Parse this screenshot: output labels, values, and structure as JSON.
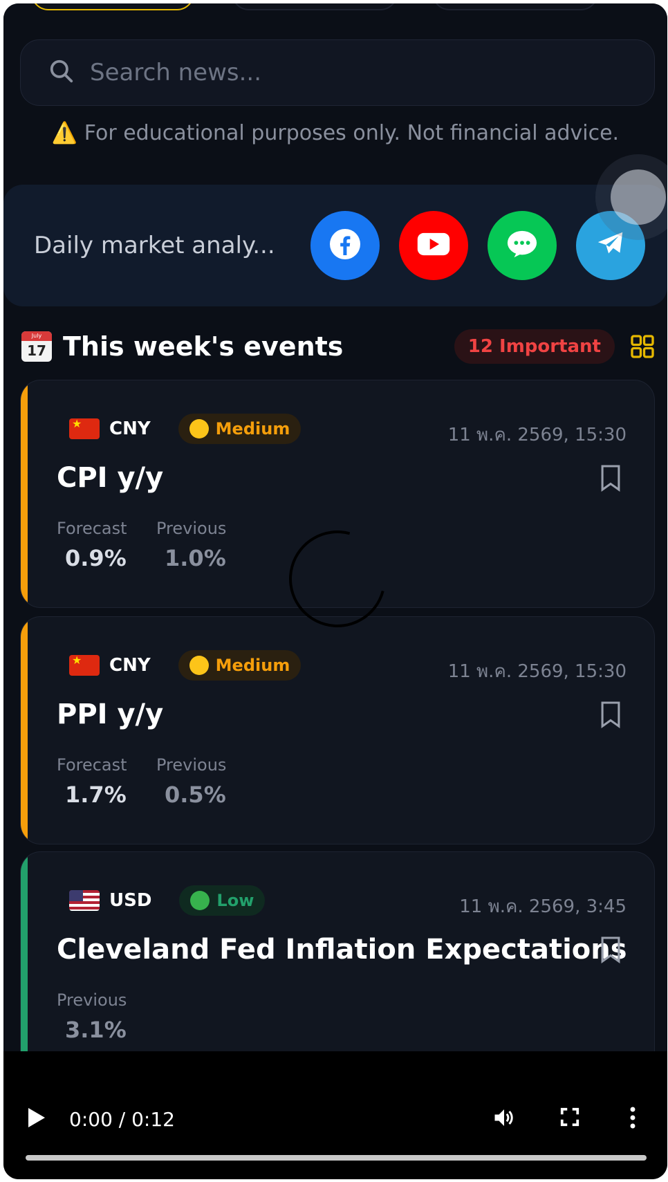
{
  "search": {
    "placeholder": "Search news..."
  },
  "disclaimer": "⚠️ For educational purposes only. Not financial advice.",
  "social": {
    "text": "Daily market analy...",
    "buttons": [
      {
        "name": "facebook",
        "color": "#1877f2"
      },
      {
        "name": "youtube",
        "color": "#ff0000"
      },
      {
        "name": "line",
        "color": "#06c755"
      },
      {
        "name": "telegram",
        "color": "#2aa3df"
      }
    ]
  },
  "section": {
    "calendar_month": "July",
    "calendar_day": "17",
    "title": "This week's events",
    "important_badge": "12 Important"
  },
  "colors": {
    "medium": "#f59e0b",
    "low": "#22a06b",
    "accent_yellow": "#e6b800"
  },
  "events": [
    {
      "currency": "CNY",
      "flag": "cn-flag",
      "impact": "Medium",
      "time": "11 พ.ค. 2569, 15:30",
      "title": "CPI y/y",
      "metrics": [
        {
          "label": "Forecast",
          "value": "0.9%"
        },
        {
          "label": "Previous",
          "value": "1.0%"
        }
      ]
    },
    {
      "currency": "CNY",
      "flag": "cn-flag",
      "impact": "Medium",
      "time": "11 พ.ค. 2569, 15:30",
      "title": "PPI y/y",
      "metrics": [
        {
          "label": "Forecast",
          "value": "1.7%"
        },
        {
          "label": "Previous",
          "value": "0.5%"
        }
      ]
    },
    {
      "currency": "USD",
      "flag": "us-flag",
      "impact": "Low",
      "time": "11 พ.ค. 2569, 3:45",
      "title": "Cleveland Fed Inflation Expectations",
      "metrics": [
        {
          "label": "Previous",
          "value": "3.1%"
        }
      ]
    }
  ],
  "video": {
    "time": "0:00 / 0:12",
    "progress": 0.0
  }
}
